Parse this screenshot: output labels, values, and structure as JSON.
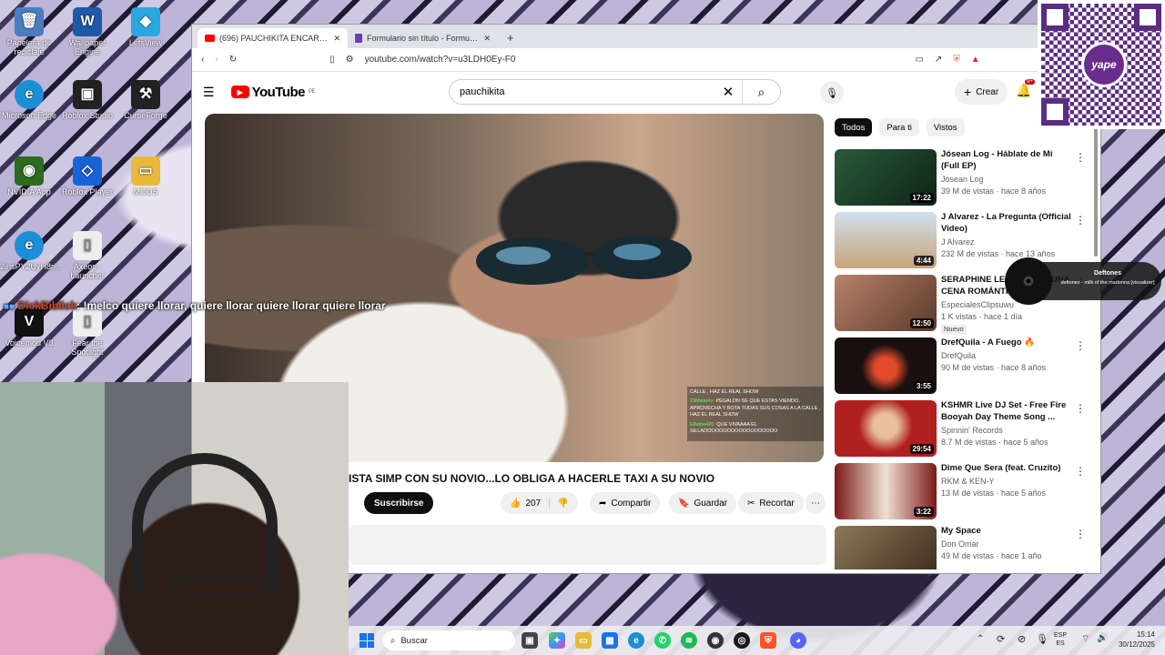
{
  "desktop": {
    "icons": [
      {
        "label": "Papelera de reciclaje",
        "color": "#4a7dbf",
        "glyph": "🗑"
      },
      {
        "label": "Wallpaper Engine",
        "color": "#1e5aa8",
        "glyph": "W"
      },
      {
        "label": "LetsView",
        "color": "#2aa7e0",
        "glyph": "◆"
      },
      {
        "label": "Microsoft Edge",
        "color": "#1b8fd6",
        "glyph": "e"
      },
      {
        "label": "Roblox Studio",
        "color": "#222",
        "glyph": "▣"
      },
      {
        "label": "CurseForge",
        "color": "#222",
        "glyph": "⚒"
      },
      {
        "label": "NVIDIA App",
        "color": "#2d6b1f",
        "glyph": "◉"
      },
      {
        "label": "Roblox Player",
        "color": "#1764d8",
        "glyph": "◇"
      },
      {
        "label": "MODS",
        "color": "#e8b93a",
        "glyph": "▭"
      },
      {
        "label": "2insPY2UyH8ri...",
        "color": "#1b8fd6",
        "glyph": "e"
      },
      {
        "label": "Axeos - Launcher",
        "color": "#eee",
        "glyph": "▯"
      },
      {
        "label": "Voicemod V3",
        "color": "#111",
        "glyph": "V"
      },
      {
        "label": "Fear the Spotlight",
        "color": "#eee",
        "glyph": "▯"
      }
    ]
  },
  "browser": {
    "tabs": [
      {
        "title": "(696) PAUCHIKITA ENCARA T...",
        "icon": "youtube-icon",
        "icon_color": "#f00"
      },
      {
        "title": "Formulario sin título - Formularios de...",
        "icon": "forms-icon",
        "icon_color": "#6a3fb5"
      }
    ],
    "new_tab": "+",
    "url": "youtube.com/watch?v=u3LDH0Ey-F0"
  },
  "youtube": {
    "logo_text": "YouTube",
    "logo_region": "PE",
    "search_value": "pauchikita",
    "create_label": "Crear",
    "notif_count": "9+",
    "video_title": "ISTA SIMP CON SU NOVIO...LO OBLIGA A HACERLE TAXI A SU NOVIO",
    "subscribe_label": "Suscribirse",
    "likes": "207",
    "share_label": "Compartir",
    "save_label": "Guardar",
    "clip_label": "Recortar",
    "overlay_chat": [
      {
        "user": "",
        "text": "CALLE , HAZ EL REAL SHOW"
      },
      {
        "user": "23Misterio:",
        "text": "PEGALON SE QUE ESTAS VIENDO, APROVECHA Y BOTA TODAS SUS COSAS A LA CALLE , HAZ EL REAL SHOW"
      },
      {
        "user": "Elbebe420:",
        "text": "QUE VIVAAAA EL SILLAOOOOOOOOOOOOOOOOOOO"
      }
    ],
    "chips": [
      "Todos",
      "Para ti",
      "Vistos"
    ],
    "recommendations": [
      {
        "title": "Jósean Log - Háblate de Mí (Full EP)",
        "channel": "Jósean Log",
        "stats": "39 M de vistas · hace 8 años",
        "duration": "17:22",
        "badge": "",
        "thumb": "#1d3c2a"
      },
      {
        "title": "J Alvarez - La Pregunta (Official Video)",
        "channel": "J Alvarez",
        "stats": "232 M de vistas · hace 13 años",
        "duration": "4:44",
        "badge": "",
        "thumb": "#c8a478"
      },
      {
        "title": "SERAPHINE LE PREPARA UNA CENA ROMÁNTICA",
        "channel": "EspecialesClipsuwu",
        "stats": "1 K vistas · hace 1 día",
        "duration": "12:50",
        "badge": "Nuevo",
        "thumb": "#8a5a44"
      },
      {
        "title": "DrefQuila - A Fuego 🔥",
        "channel": "DrefQuila",
        "stats": "90 M de vistas · hace 8 años",
        "duration": "3:55",
        "badge": "",
        "thumb": "#1a1010"
      },
      {
        "title": "KSHMR Live DJ Set - Free Fire Booyah Day Theme Song ...",
        "channel": "Spinnin' Records",
        "stats": "8.7 M de vistas · hace 5 años",
        "duration": "29:54",
        "badge": "",
        "thumb": "#b02020"
      },
      {
        "title": "Dime Que Sera (feat. Cruzito)",
        "channel": "RKM & KEN-Y",
        "stats": "13 M de vistas · hace 5 años",
        "duration": "3:22",
        "badge": "",
        "thumb": "#6a1a1a"
      },
      {
        "title": "My Space",
        "channel": "Don Omar",
        "stats": "49 M de vistas · hace 1 año",
        "duration": "",
        "badge": "",
        "thumb": "#5a4a3a"
      }
    ]
  },
  "stream_chat": {
    "user": "DickBiblick",
    "message": ": !melco quiere llorar, quiere llorar quiere llorar quiere llorar"
  },
  "qr": {
    "brand": "yape"
  },
  "now_playing": {
    "artist": "Deftones",
    "song": "deftones - milk of the madonna [visualizer]"
  },
  "taskbar": {
    "search_placeholder": "Buscar",
    "lang_top": "ESP",
    "lang_bottom": "ES",
    "time": "15:14",
    "date": "30/12/2025"
  }
}
